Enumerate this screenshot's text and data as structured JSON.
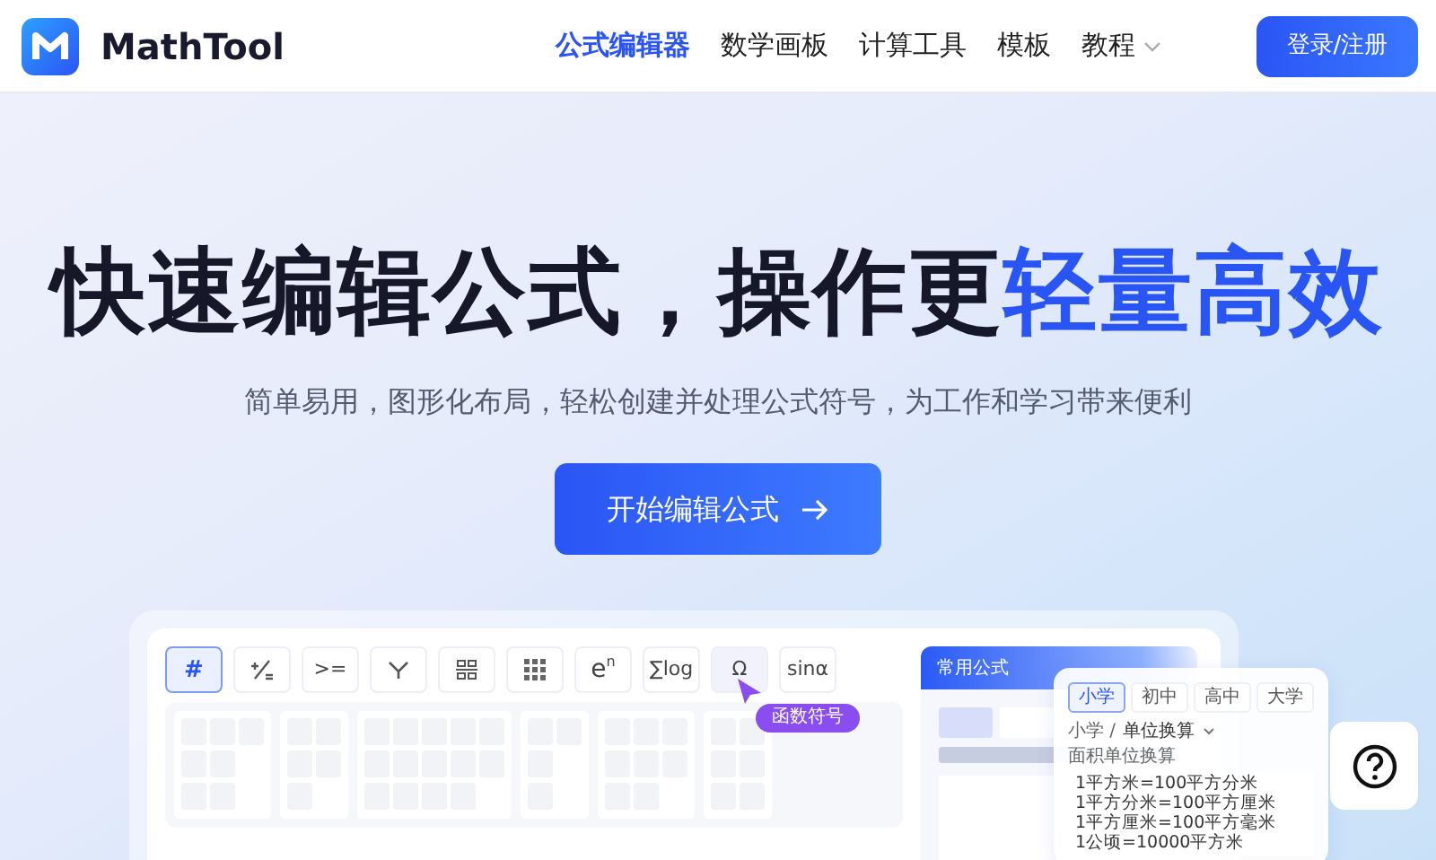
{
  "logo": {
    "name": "MathTool"
  },
  "nav": [
    {
      "label": "公式编辑器",
      "selected": true,
      "dropdown": false
    },
    {
      "label": "数学画板",
      "selected": false,
      "dropdown": false
    },
    {
      "label": "计算工具",
      "selected": false,
      "dropdown": false
    },
    {
      "label": "模板",
      "selected": false,
      "dropdown": false
    },
    {
      "label": "教程",
      "selected": false,
      "dropdown": true
    }
  ],
  "login_button": "登录/注册",
  "hero": {
    "title": "快速编辑公式，操作更",
    "title_highlight": "轻量高效",
    "subtitle": "简单易用，图形化布局，轻松创建并处理公式符号，为工作和学习带来便利",
    "cta": "开始编辑公式"
  },
  "editor_preview": {
    "toolbar": [
      {
        "kind": "text",
        "label": "#",
        "selected": true,
        "hovered": false
      },
      {
        "kind": "fraction",
        "selected": false,
        "hovered": false
      },
      {
        "kind": "text",
        "label": ">=",
        "selected": false,
        "hovered": false
      },
      {
        "kind": "branch",
        "selected": false,
        "hovered": false
      },
      {
        "kind": "stack",
        "selected": false,
        "hovered": false
      },
      {
        "kind": "grid",
        "selected": false,
        "hovered": false
      },
      {
        "kind": "power",
        "label": "e",
        "sup": "n",
        "selected": false,
        "hovered": false
      },
      {
        "kind": "text",
        "label": "∑log",
        "selected": false,
        "hovered": false
      },
      {
        "kind": "text",
        "label": "Ω",
        "selected": false,
        "hovered": true
      },
      {
        "kind": "text",
        "label": "sinα",
        "selected": false,
        "hovered": false
      }
    ],
    "tooltip": "函数符号",
    "side_panel": {
      "title": "常用公式"
    }
  },
  "formula_card": {
    "levels": [
      {
        "label": "小学",
        "selected": true
      },
      {
        "label": "初中",
        "selected": false
      },
      {
        "label": "高中",
        "selected": false
      },
      {
        "label": "大学",
        "selected": false
      }
    ],
    "breadcrumb": {
      "root": "小学 /",
      "current": "单位换算"
    },
    "section": "面积单位换算",
    "formulas": [
      "1平方米=100平方分米",
      "1平方分米=100平方厘米",
      "1平方厘米=100平方毫米",
      "1公顷=10000平方米"
    ]
  }
}
